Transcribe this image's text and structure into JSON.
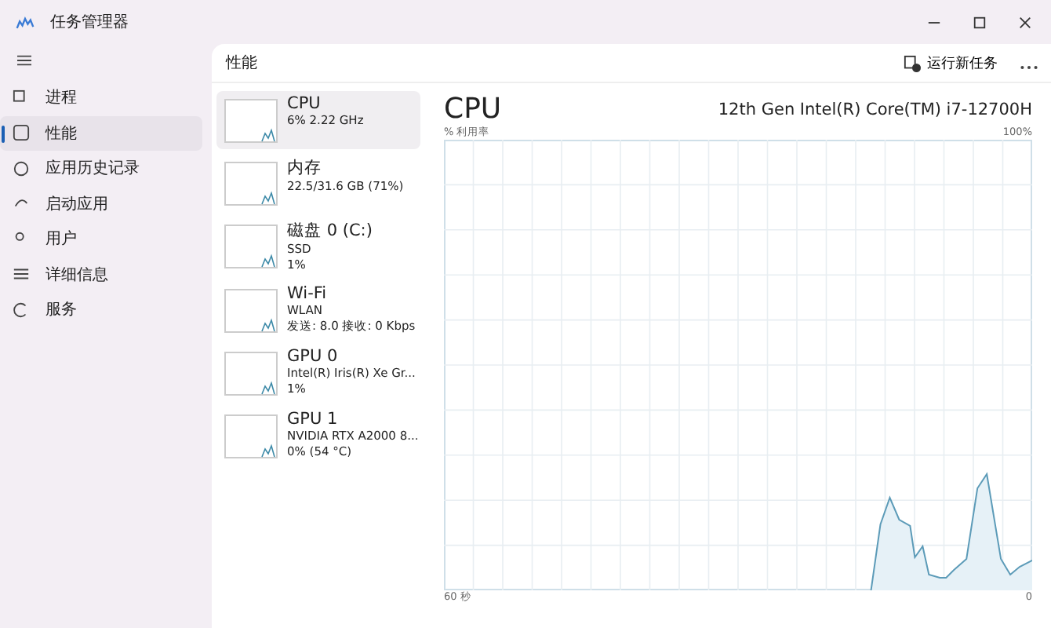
{
  "window": {
    "title": "任务管理器"
  },
  "nav": [
    {
      "label": "进程",
      "selected": false
    },
    {
      "label": "性能",
      "selected": true
    },
    {
      "label": "应用历史记录",
      "selected": false
    },
    {
      "label": "启动应用",
      "selected": false
    },
    {
      "label": "用户",
      "selected": false
    },
    {
      "label": "详细信息",
      "selected": false
    },
    {
      "label": "服务",
      "selected": false
    }
  ],
  "header": {
    "title": "性能",
    "run_task": "运行新任务"
  },
  "devices": [
    {
      "name": "CPU",
      "lines": [
        "6% 2.22 GHz"
      ],
      "selected": true
    },
    {
      "name": "内存",
      "lines": [
        "22.5/31.6 GB (71%)"
      ],
      "selected": false
    },
    {
      "name": "磁盘 0 (C:)",
      "lines": [
        "SSD",
        "1%"
      ],
      "selected": false
    },
    {
      "name": "Wi-Fi",
      "lines": [
        "WLAN",
        "发送: 8.0 接收: 0 Kbps"
      ],
      "selected": false
    },
    {
      "name": "GPU 0",
      "lines": [
        "Intel(R) Iris(R) Xe Gr...",
        "1%"
      ],
      "selected": false
    },
    {
      "name": "GPU 1",
      "lines": [
        "NVIDIA RTX A2000 8...",
        "0% (54 °C)"
      ],
      "selected": false
    }
  ],
  "detail": {
    "title": "CPU",
    "model": "12th Gen Intel(R) Core(TM) i7-12700H",
    "y_label": "% 利用率",
    "y_max": "100%",
    "x_start": "60 秒",
    "x_end": "0"
  }
}
